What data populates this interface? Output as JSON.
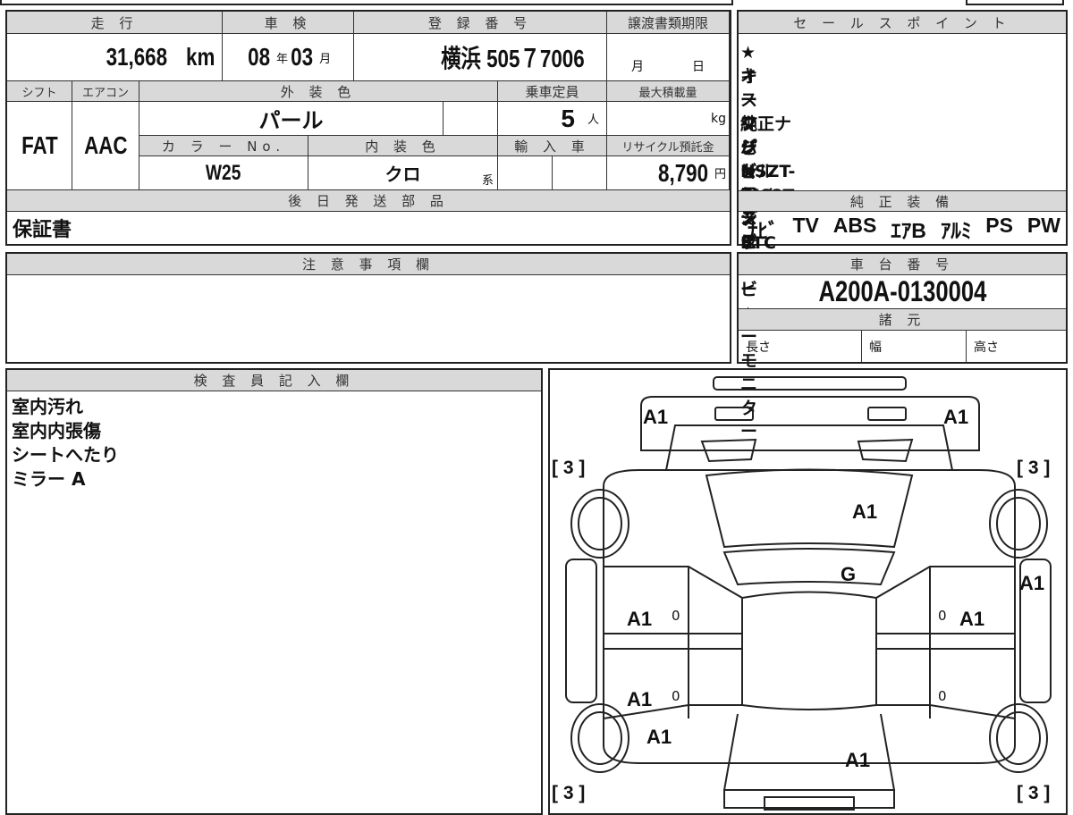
{
  "vehicle": {
    "mileage_label": "走 行",
    "mileage": "31,668",
    "mileage_unit": "km",
    "inspection_label": "車 検",
    "insp_year": "08",
    "year_unit": "年",
    "insp_month": "03",
    "month_unit": "月",
    "reg_label": "登 録 番 号",
    "reg_number": "横浜 505７7006",
    "transfer_label": "譲渡書類期限",
    "transfer_month": "月",
    "transfer_day": "日",
    "shift_label": "シフト",
    "ac_label": "エアコン",
    "ext_color_label": "外 装 色",
    "capacity_label": "乗車定員",
    "max_load_label": "最大積載量",
    "shift": "FAT",
    "ac": "AAC",
    "ext_color": "パール",
    "capacity": "5",
    "capacity_unit": "人",
    "load_unit": "kg",
    "color_no_label": "カ ラ ー No.",
    "int_color_label": "内 装 色",
    "import_label": "輸 入 車",
    "recycle_label": "リサイクル預託金",
    "color_no": "W25",
    "int_color": "クロ",
    "int_color_suffix": "系",
    "recycle_fee": "8,790",
    "recycle_unit": "円",
    "later_parts_label": "後 日 発 送 部 品",
    "later_parts": "保証書"
  },
  "sales_points": {
    "label": "セ ー ル ス ポ イ ン ト",
    "items": [
      "★オークションデビュー★",
      "キーフリーシステム",
      "スマートアシスト",
      "純正ナビNSZT-W68T",
      "パノラミックビューモニター",
      "ビルトインETC"
    ]
  },
  "equipment": {
    "label": "純 正 装 備",
    "items": [
      "ﾅﾋﾞ",
      "TV",
      "ABS",
      "ｴｱB",
      "ｱﾙﾐ",
      "PS",
      "PW"
    ]
  },
  "notes": {
    "label": "注 意 事 項 欄"
  },
  "chassis": {
    "label": "車 台 番 号",
    "value": "A200A-0130004",
    "spec_label": "諸 元",
    "length": "長さ",
    "width": "幅",
    "height": "高さ"
  },
  "inspector": {
    "label": "検 査 員 記 入 欄",
    "lines": [
      "室内汚れ",
      "室内内張傷",
      "シートへたり",
      "ミラー A"
    ]
  },
  "diagram": {
    "marks": [
      "A1",
      "A1",
      "A1",
      "G",
      "A1",
      "A1",
      "A1",
      "A1",
      "A1",
      "A1",
      "A1"
    ],
    "brackets": [
      "[ 3 ]",
      "[ 3 ]",
      "[ 3 ]",
      "[ 3 ]"
    ],
    "zero": "0"
  }
}
